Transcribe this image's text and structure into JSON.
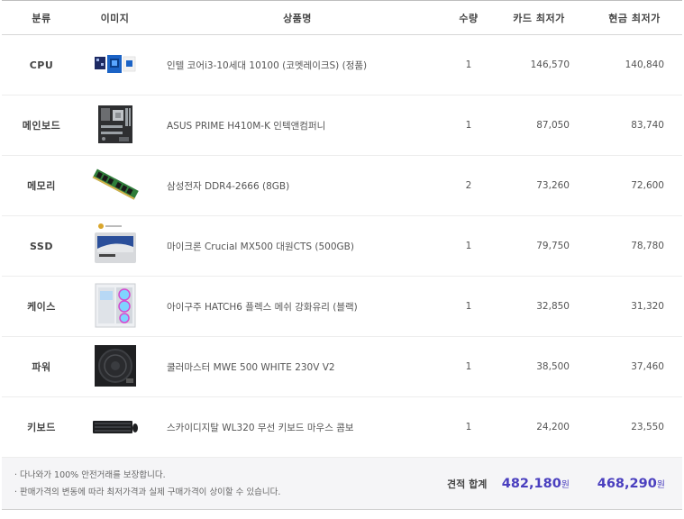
{
  "columns": {
    "category": "분류",
    "image": "이미지",
    "product": "상품명",
    "quantity": "수량",
    "card_price": "카드 최저가",
    "cash_price": "현금 최저가"
  },
  "rows": [
    {
      "category": "CPU",
      "product": "인텔 코어i3-10세대 10100 (코멧레이크S) (정품)",
      "quantity": "1",
      "card_price": "146,570",
      "cash_price": "140,840",
      "image_icon": "cpu-box-icon"
    },
    {
      "category": "메인보드",
      "product": "ASUS PRIME H410M-K 인텍앤컴퍼니",
      "quantity": "1",
      "card_price": "87,050",
      "cash_price": "83,740",
      "image_icon": "motherboard-icon"
    },
    {
      "category": "메모리",
      "product": "삼성전자 DDR4-2666 (8GB)",
      "quantity": "2",
      "card_price": "73,260",
      "cash_price": "72,600",
      "image_icon": "ram-stick-icon"
    },
    {
      "category": "SSD",
      "product": "마이크론 Crucial MX500 대원CTS (500GB)",
      "quantity": "1",
      "card_price": "79,750",
      "cash_price": "78,780",
      "image_icon": "ssd-icon"
    },
    {
      "category": "케이스",
      "product": "아이구주 HATCH6 플렉스 메쉬 강화유리 (블랙)",
      "quantity": "1",
      "card_price": "32,850",
      "cash_price": "31,320",
      "image_icon": "pc-case-icon"
    },
    {
      "category": "파워",
      "product": "쿨러마스터 MWE 500 WHITE 230V V2",
      "quantity": "1",
      "card_price": "38,500",
      "cash_price": "37,460",
      "image_icon": "power-supply-icon"
    },
    {
      "category": "키보드",
      "product": "스카이디지탈 WL320 무선 키보드 마우스 콤보",
      "quantity": "1",
      "card_price": "24,200",
      "cash_price": "23,550",
      "image_icon": "keyboard-icon"
    }
  ],
  "footer": {
    "note1": "· 다나와가 100% 안전거래를 보장합니다.",
    "note2": "· 판매가격의 변동에 따라 최저가격과 실제 구매가격이 상이할 수 있습니다.",
    "total_label": "견적 합계",
    "card_total": "482,180",
    "cash_total": "468,290",
    "currency": "원"
  },
  "colors": {
    "accent": "#4a3fbf",
    "footer_bg": "#f5f5f7"
  }
}
